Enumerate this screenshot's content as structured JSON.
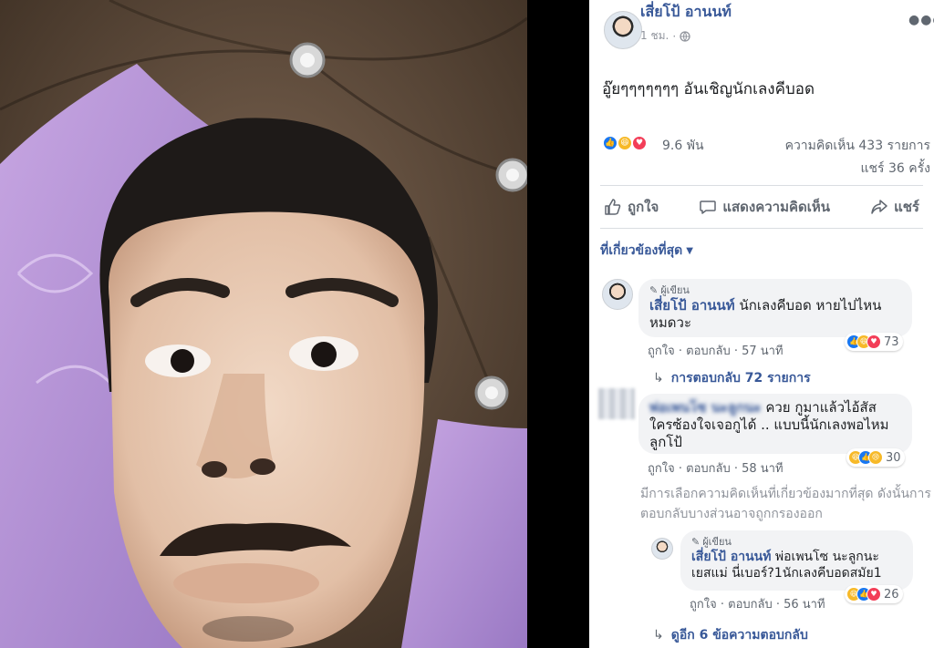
{
  "post": {
    "author": "เสี่ยโป้ อานนท์",
    "time": "1 ชม.",
    "privacy_icon": "globe-icon",
    "more_icon": "more-options-icon",
    "text": "อู๊ยๆๆๆๆๆๆๆ อันเชิญนักเลงคีบอด"
  },
  "stats": {
    "reactions": "9.6 พัน",
    "comments": "ความคิดเห็น 433 รายการ",
    "shares": "แชร์ 36 ครั้ง"
  },
  "actions": {
    "like": "ถูกใจ",
    "comment": "แสดงความคิดเห็น",
    "share": "แชร์"
  },
  "filter": {
    "label": "ที่เกี่ยวข้องที่สุด"
  },
  "comments": [
    {
      "badge": "ผู้เขียน",
      "name": "เสี่ยโป้ อานนท์",
      "text_line1": "นักเลงคีบอด หายไปไหน",
      "text_line2": "หมดวะ",
      "like": "ถูกใจ",
      "reply": "ตอบกลับ",
      "time": "57 นาที",
      "reaction_count": "73",
      "replies": "การตอบกลับ 72 รายการ"
    },
    {
      "name": "พ่อเพนโซ นะลูกนะ",
      "text_line1": "ควย กูมาแล้วไอ้สัส",
      "text_line2": "ใครซ้องใจเจอกูได้ .. แบบนี้นักเลงพอไหม",
      "text_line3": "ลูกโป้",
      "like": "ถูกใจ",
      "reply": "ตอบกลับ",
      "time": "58 นาที",
      "reaction_count": "30"
    },
    {
      "badge": "ผู้เขียน",
      "name": "เสี่ยโป้ อานนท์",
      "text_line1": "พ่อเพนโซ นะลูกนะ",
      "text_line2": "เยสแม่ นี่เบอร์?1นักเลงคีบอดสมัย1",
      "like": "ถูกใจ",
      "reply": "ตอบกลับ",
      "time": "56 นาที",
      "reaction_count": "26"
    }
  ],
  "filtered_note": "มีการเลือกความคิดเห็นที่เกี่ยวข้องมากที่สุด ดังนั้นการตอบกลับบางส่วนอาจถูกกรองออก",
  "more_replies": "ดูอีก 6 ข้อความตอบกลับ",
  "colors": {
    "link": "#385898",
    "like": "#1877f2",
    "love": "#f33e58",
    "haha": "#f7b928"
  }
}
